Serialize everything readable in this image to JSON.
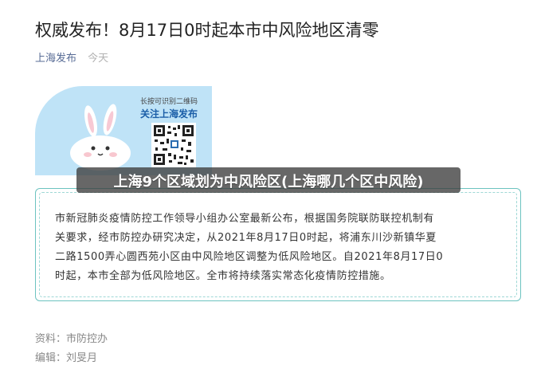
{
  "article": {
    "title": "权威发布！8月17日0时起本市中风险地区清零",
    "source": "上海发布",
    "time": "今天"
  },
  "banner": {
    "qr_hint": "长按可识别二维码",
    "qr_follow": "关注上海发布",
    "bg_color": "#bfe3f7"
  },
  "overlay": {
    "caption": "上海9个区域划为中风险区(上海哪几个区中风险)"
  },
  "notice": {
    "lines": [
      "市新冠肺炎疫情防控工作领导小组办公室最新公布，根据国务院联防联控机制有",
      "关要求，经市防控办研究决定，从2021年8月17日0时起，将浦东川沙新镇华夏",
      "二路1500弄心圆西苑小区由中风险地区调整为低风险地区。自2021年8月17日0",
      "时起，本市全部为低风险地区。全市将持续落实常态化疫情防控措施。"
    ],
    "border_color": "#6cc3c0"
  },
  "footer": {
    "material_label": "资料：",
    "material_value": "市防控办",
    "editor_label": "编辑：",
    "editor_value": "刘旻月"
  }
}
